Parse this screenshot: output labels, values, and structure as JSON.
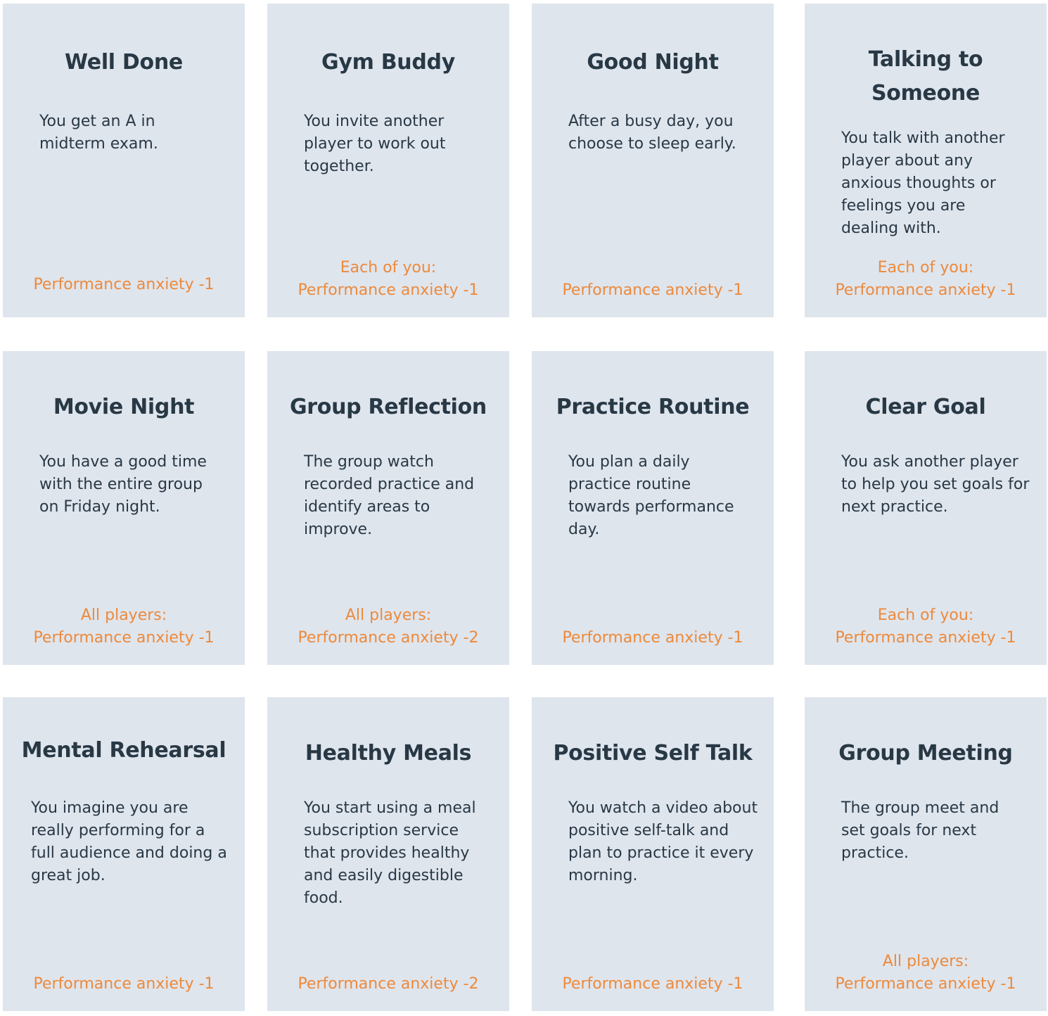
{
  "cards": [
    {
      "title": "Well Done",
      "description": "You get an A in midterm exam.",
      "effect_target": "",
      "effect": "Performance anxiety -1"
    },
    {
      "title": "Gym Buddy",
      "description": "You invite another player to work out together.",
      "effect_target": "Each of you:",
      "effect": "Performance anxiety -1"
    },
    {
      "title": "Good Night",
      "description": "After a busy day, you choose to sleep early.",
      "effect_target": "",
      "effect": "Performance anxiety -1"
    },
    {
      "title": "Talking to Someone",
      "description": "You talk with another player about any anxious thoughts or feelings you are dealing with.",
      "effect_target": "Each of you:",
      "effect": "Performance anxiety -1"
    },
    {
      "title": "Movie Night",
      "description": "You have a good time with the entire group on Friday night.",
      "effect_target": "All players:",
      "effect": "Performance anxiety -1"
    },
    {
      "title": "Group Reflection",
      "description": "The group watch recorded practice and identify areas to improve.",
      "effect_target": "All players:",
      "effect": "Performance anxiety -2"
    },
    {
      "title": "Practice Routine",
      "description": "You plan a daily practice routine towards performance day.",
      "effect_target": "",
      "effect": "Performance anxiety -1"
    },
    {
      "title": "Clear Goal",
      "description": "You ask another player to help you set goals for next practice.",
      "effect_target": "Each of you:",
      "effect": "Performance anxiety -1"
    },
    {
      "title": "Mental Rehearsal",
      "description": "You imagine you are really performing for a full audience and doing a great job.",
      "effect_target": "",
      "effect": "Performance anxiety -1"
    },
    {
      "title": "Healthy Meals",
      "description": "You start using a meal subscription service that provides healthy and easily digestible food.",
      "effect_target": "",
      "effect": "Performance anxiety -2"
    },
    {
      "title": "Positive Self Talk",
      "description": "You watch a video about positive self-talk and plan to practice it every morning.",
      "effect_target": "",
      "effect": "Performance anxiety -1"
    },
    {
      "title": "Group Meeting",
      "description": "The group meet and set goals for next practice.",
      "effect_target": "All players:",
      "effect": "Performance anxiety -1"
    }
  ],
  "colors": {
    "card_background": "#dfe5ed",
    "text": "#283845",
    "effect": "#ec8a3c"
  }
}
